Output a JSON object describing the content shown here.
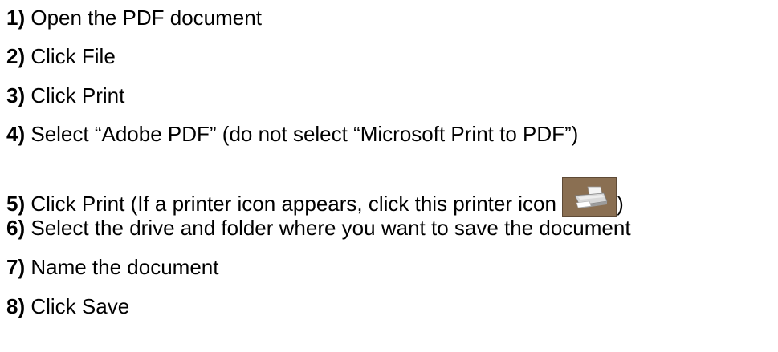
{
  "steps": [
    {
      "number": "1)",
      "text": " Open the PDF document"
    },
    {
      "number": "2)",
      "text": " Click File"
    },
    {
      "number": "3)",
      "text": " Click Print"
    },
    {
      "number": "4)",
      "text": " Select “Adobe PDF” (do not select “Microsoft Print to PDF”)"
    },
    {
      "number": "5)",
      "text": " Click Print (If a printer icon appears, click this printer icon ",
      "text_after": ")",
      "icon": "printer-icon"
    },
    {
      "number": "6)",
      "text": " Select the drive and folder where you want to save the document"
    },
    {
      "number": "7)",
      "text": " Name the document"
    },
    {
      "number": "8)",
      "text": " Click Save"
    }
  ],
  "colors": {
    "text": "#000000",
    "background": "#ffffff",
    "icon_background": "#8a6f52"
  }
}
